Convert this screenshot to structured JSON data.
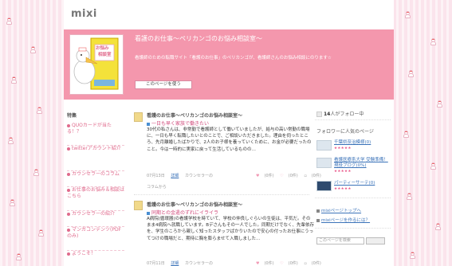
{
  "header": {
    "logo": "mixi"
  },
  "banner": {
    "title": "看護のお仕事～ペリカンゴのお悩み相談室～",
    "description": "看護師のための転職サイト「看護のお仕事」のペリカンゴが、看護師さんのお悩み相談にのります☆",
    "follow_button": "このページを使う",
    "thumb_label_1": "お悩み",
    "thumb_label_2": "相談室"
  },
  "left_nav": {
    "title": "特集",
    "items": [
      {
        "label": "QUOカードが当たる！？"
      },
      {
        "label": "twitterアカウント紹介"
      },
      {
        "label": "カウンセラーのコラム"
      },
      {
        "label": "お仕事のお悩み＆相談はこちら"
      },
      {
        "label": "カウンセラーの紹介"
      },
      {
        "label": "マンガコンテンツ(PDFのみ)"
      },
      {
        "label": "ようこそ！"
      }
    ]
  },
  "posts": [
    {
      "page": "看護のお仕事～ペリカンゴのお悩み相談室～",
      "title": "一日も早く家族で働きたい",
      "body": "30代の私さんは、非常勤で看護師として働いていましたが、給与の高い常勤の職場に、一日も早く転職したいとのことで、ご相談いただきました。理由を伺ったところ、先月離婚したばかりで、2人のお子様を養っていくために、お金が必要だったのこと。今は一時的に実家に戻って生活しているものの…",
      "date": "07月13日",
      "detail": "詳細",
      "author": "カウンセラーの",
      "count1": "(0件)",
      "count2": "(0件)",
      "comment": "(0件)",
      "source": "コラムから"
    },
    {
      "page": "看護のお仕事～ペリカンゴのお悩み相談室～",
      "title": "同期との金遣のずれにイライラ",
      "body": "A病院(循環器)の看護学校を時ていて、学校の仲良しぐらいの生徒は、平気だ。そのまま4病院へ就職しています。Bデさんもその一人でした。同期だけでなく、先輩依存を、学生のころから親しく知ったスタッフばかりいたので安心の付ったお仕事にうってつけの職場だと、期待に胸を膨らませて入職しました…",
      "date": "07月11日",
      "detail": "詳細",
      "author": "カウンセラーの",
      "count1": "(0件)",
      "count2": "(0件)",
      "comment": "(0件)",
      "source": ""
    }
  ],
  "right": {
    "follow_count_prefix": "",
    "follow_count": "14",
    "follow_suffix": "人がフォロー中",
    "popular_title": "フォロワーに人気のページ",
    "favorites": [
      {
        "label": "千葉県奈治模様(0)",
        "stars": "★★★★★"
      },
      {
        "label": "看護医療系大学 受験準備！現役ブログ(0%)",
        "stars": "★★★★★"
      },
      {
        "label": "パーティーサーテ(0)",
        "stars": "★★★★★"
      }
    ],
    "links": [
      {
        "label": "mixiページトップへ"
      },
      {
        "label": "mixiページを作るには？"
      }
    ],
    "search_placeholder": "このページを検索"
  },
  "colors": {
    "pink_banner": "#f497ad",
    "pink_link": "#e06a8c",
    "blue_link": "#3b73b9"
  }
}
